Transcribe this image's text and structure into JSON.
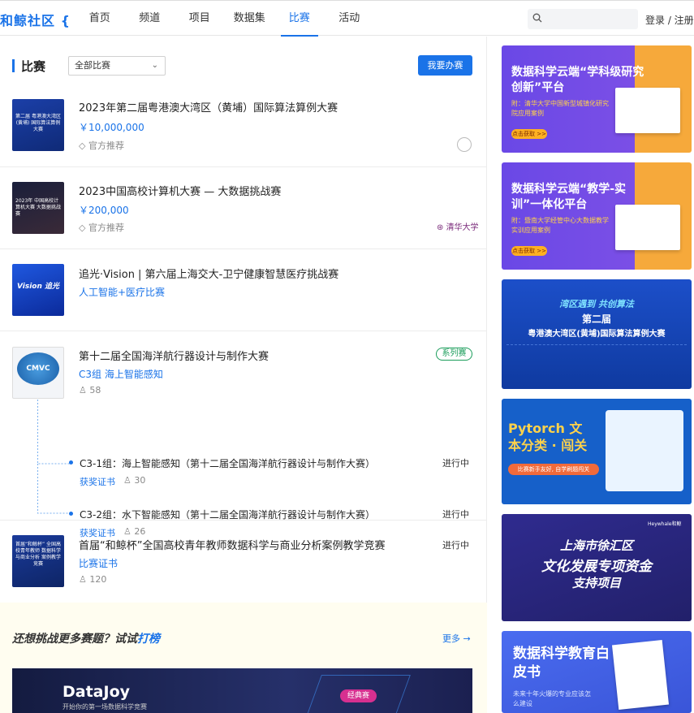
{
  "header": {
    "logo": "和鲸社区",
    "nav": [
      "首页",
      "频道",
      "项目",
      "数据集",
      "比赛",
      "活动"
    ],
    "active_nav": "比赛",
    "search_placeholder": "",
    "login": "登录 / 注册"
  },
  "section": {
    "title": "比赛",
    "filter_value": "全部比赛",
    "host_button": "我要办赛"
  },
  "competitions": [
    {
      "title": "2023年第二届粤港澳大湾区（黄埔）国际算法算例大赛",
      "prize": "￥10,000,000",
      "tag": "官方推荐",
      "thumb_text": "第二届 粤港澳大湾区(黄埔) 国际算法算例大赛"
    },
    {
      "title": "2023中国高校计算机大赛 — 大数据挑战赛",
      "prize": "￥200,000",
      "tag": "官方推荐",
      "thumb_text": "2023年 中国高校计算机大赛 大数据挑战赛",
      "org": "清华大学"
    },
    {
      "title": "追光·Vision | 第六届上海交大-卫宁健康智慧医疗挑战赛",
      "category": "人工智能+医疗比赛",
      "thumb_text": "Vision 追光"
    },
    {
      "title": "第十二届全国海洋航行器设计与制作大赛",
      "badge": "系列赛",
      "group": "C3组 海上智能感知",
      "count": "58",
      "thumb_text": "CMVC",
      "subs": [
        {
          "title": "C3-1组：海上智能感知（第十二届全国海洋航行器设计与制作大赛）",
          "status": "进行中",
          "cert": "获奖证书",
          "count": "30"
        },
        {
          "title": "C3-2组：水下智能感知（第十二届全国海洋航行器设计与制作大赛）",
          "status": "进行中",
          "cert": "获奖证书",
          "count": "26"
        }
      ]
    },
    {
      "title": "首届“和鲸杯”全国高校青年教师数据科学与商业分析案例教学竞赛",
      "status": "进行中",
      "cert": "比赛证书",
      "count": "120",
      "thumb_text": "首届“和鲸杯” 全国高校青年教师 数据科学与商业分析 案例教学竞赛"
    }
  ],
  "more": {
    "question": "还想挑战更多赛题？试试",
    "highlight": "打榜",
    "link": "更多 →"
  },
  "datajoy": {
    "title": "DataJoy",
    "subtitle": "开始你的第一场数据科学竞赛",
    "tag": "经典赛"
  },
  "banners": [
    {
      "title": "数据科学云端“学科级研究创新”平台",
      "sub": "附：清华大学中国新型城镇化研究院应用案例",
      "button": "点击获取 >>",
      "color": "#7b4fe6"
    },
    {
      "title": "数据科学云端“教学-实训”一体化平台",
      "sub": "附：暨南大学经管中心大数据教学实训应用案例",
      "button": "点击获取 >>",
      "color": "#7b4fe6"
    },
    {
      "title": "湾区遇到 共创算法",
      "title2": "第二届",
      "title3": "粤港澳大湾区(黄埔)国际算法算例大赛",
      "color": "#1c4fc9"
    },
    {
      "title": "Pytorch 文本分类 · 闯关",
      "sub": "比赛新手友好, 自学刷题闯关",
      "color": "#1660c9"
    },
    {
      "title": "上海市徐汇区",
      "title2": "文化发展专项资金",
      "title3": "支持项目",
      "brand": "Heywhale和鲸",
      "color": "#2a2a8a"
    },
    {
      "title": "数据科学教育白皮书",
      "sub": "未来十年火爆的专业应该怎么建设",
      "color": "#4a6cf0"
    }
  ]
}
